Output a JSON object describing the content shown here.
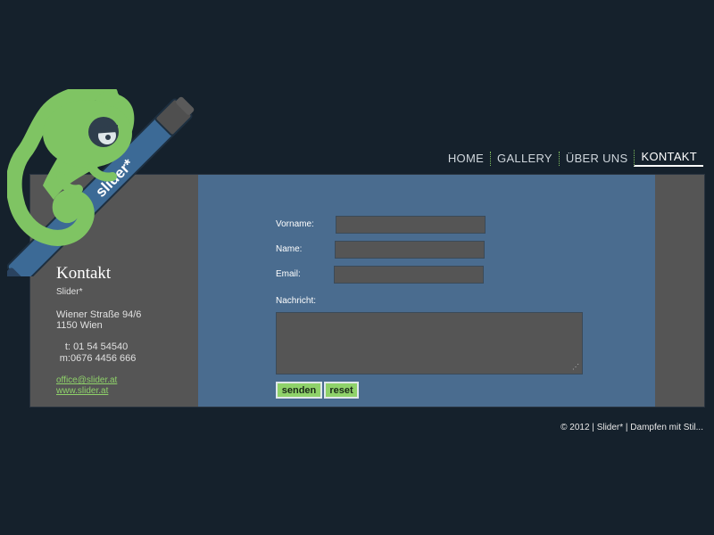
{
  "nav": {
    "items": [
      {
        "label": "HOME",
        "active": false
      },
      {
        "label": "GALLERY",
        "active": false
      },
      {
        "label": "ÜBER UNS",
        "active": false
      },
      {
        "label": "KONTAKT",
        "active": true
      }
    ]
  },
  "logo": {
    "text": "slider*"
  },
  "contact": {
    "title": "Kontakt",
    "company": "Slider*",
    "street": "Wiener Straße 94/6",
    "city": "1150 Wien",
    "phone_label": "t:",
    "phone": "01 54 54540",
    "mobile_label": "m:",
    "mobile": "0676 4456 666",
    "email": "office@slider.at",
    "web": "www.slider.at"
  },
  "form": {
    "vorname_label": "Vorname:",
    "name_label": "Name:",
    "email_label": "Email:",
    "nachricht_label": "Nachricht:",
    "submit_label": "senden",
    "reset_label": "reset"
  },
  "footer": {
    "text": "© 2012 | Slider* | Dampfen mit Stil..."
  },
  "colors": {
    "background": "#15212c",
    "panel_blue": "#4a6c8f",
    "panel_gray": "#555555",
    "accent_green": "#8fd26a"
  }
}
